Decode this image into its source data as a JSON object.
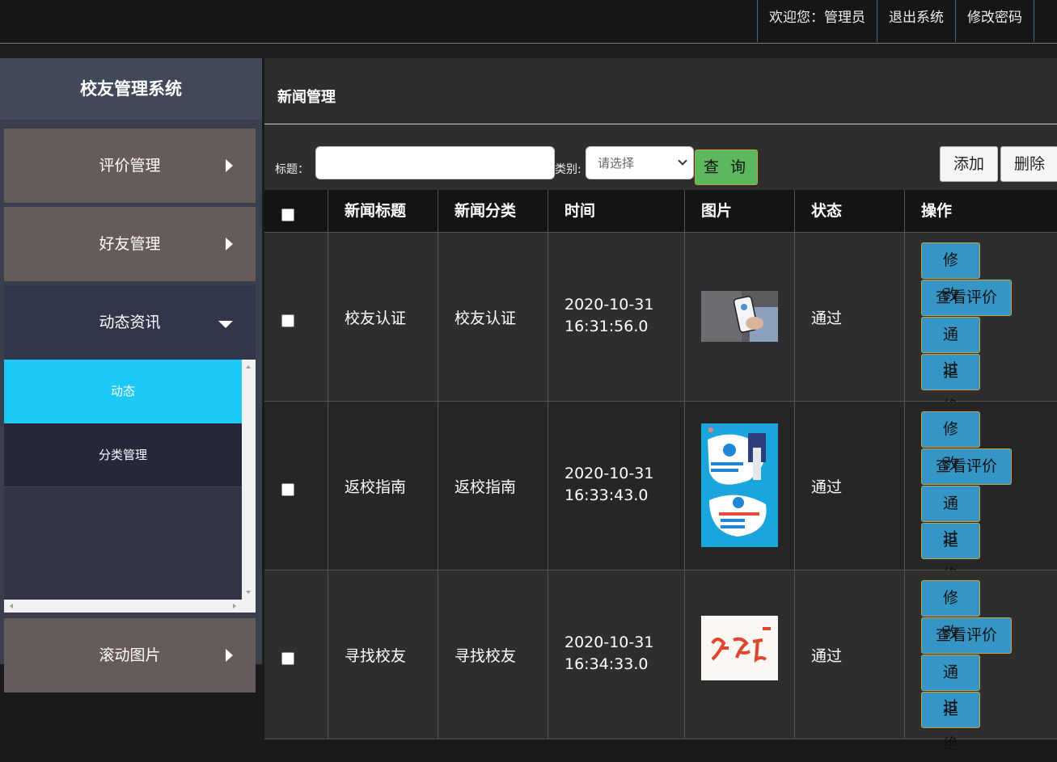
{
  "topnav": {
    "welcome": "欢迎您：管理员",
    "logout": "退出系统",
    "change_password": "修改密码"
  },
  "sidebar": {
    "title": "校友管理系统",
    "items": [
      {
        "label": "评价管理",
        "icon": "caret-right-icon"
      },
      {
        "label": "好友管理",
        "icon": "caret-right-icon"
      },
      {
        "label": "动态资讯",
        "icon": "caret-down-icon",
        "expanded": true
      },
      {
        "label": "滚动图片",
        "icon": "caret-right-icon"
      }
    ],
    "submenu": [
      {
        "label": "动态",
        "active": true
      },
      {
        "label": "分类管理",
        "active": false
      }
    ]
  },
  "main": {
    "page_title": "新闻管理",
    "search": {
      "title_label": "标题：",
      "title_value": "",
      "category_label": "类别:",
      "category_selected": "请选择",
      "query_button": "查 询",
      "add_button": "添加",
      "delete_button": "删除"
    },
    "table": {
      "headers": [
        "新闻标题",
        "新闻分类",
        "时间",
        "图片",
        "状态",
        "操作"
      ],
      "rows": [
        {
          "title": "校友认证",
          "category": "校友认证",
          "date": "2020-10-31",
          "time": "16:31:56.0",
          "status": "通过"
        },
        {
          "title": "返校指南",
          "category": "返校指南",
          "date": "2020-10-31",
          "time": "16:33:43.0",
          "status": "通过"
        },
        {
          "title": "寻找校友",
          "category": "寻找校友",
          "date": "2020-10-31",
          "time": "16:34:33.0",
          "status": "通过"
        }
      ],
      "actions": {
        "edit": "修改",
        "view_reviews": "查看评价",
        "approve": "通过",
        "reject": "拒绝"
      }
    }
  },
  "colors": {
    "active_submenu": "#1ec8f5",
    "query_button": "#5cb85c",
    "action_button": "#3596c5"
  }
}
